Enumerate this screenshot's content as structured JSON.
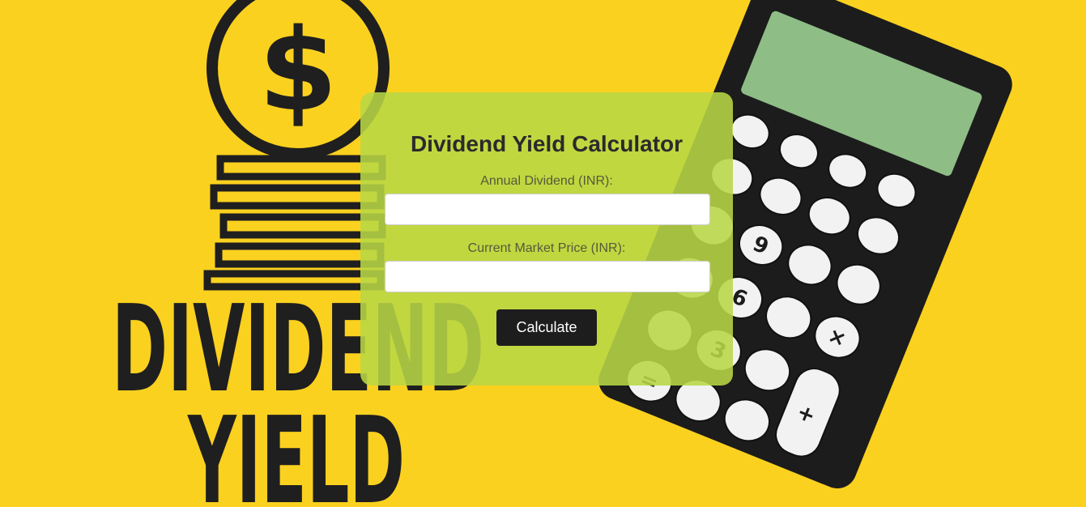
{
  "background": {
    "color": "#fbd11f",
    "art_text_line1": "DIVIDEND",
    "art_text_line2": "YIELD",
    "coin_symbol": "$",
    "icons": [
      "coin-stack-icon",
      "calculator-icon"
    ]
  },
  "calculator": {
    "title": "Dividend Yield Calculator",
    "annual_dividend": {
      "label": "Annual Dividend (INR):",
      "value": "",
      "placeholder": ""
    },
    "market_price": {
      "label": "Current Market Price (INR):",
      "value": "",
      "placeholder": ""
    },
    "calculate_label": "Calculate",
    "card_color": "#b8d746",
    "button_color": "#1d1d1d"
  }
}
